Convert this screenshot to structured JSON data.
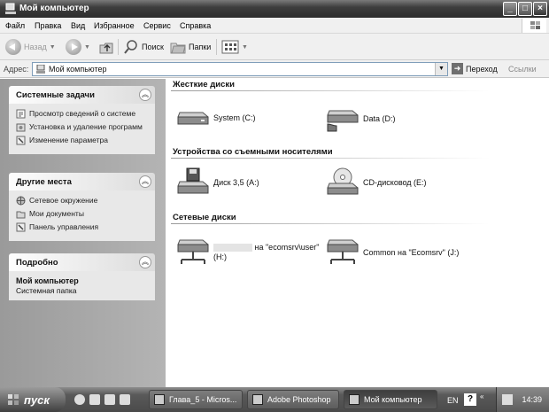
{
  "window": {
    "title": "Мой компьютер"
  },
  "menu": [
    "Файл",
    "Правка",
    "Вид",
    "Избранное",
    "Сервис",
    "Справка"
  ],
  "toolbar": {
    "back": "Назад",
    "search": "Поиск",
    "folders": "Папки"
  },
  "address": {
    "label": "Адрес:",
    "value": "Мой компьютер",
    "go": "Переход",
    "links": "Ссылки"
  },
  "sidebar": {
    "system_tasks": {
      "title": "Системные задачи",
      "items": [
        "Просмотр сведений о системе",
        "Установка и удаление программ",
        "Изменение параметра"
      ]
    },
    "other_places": {
      "title": "Другие места",
      "items": [
        "Сетевое окружение",
        "Мои документы",
        "Панель управления"
      ]
    },
    "details": {
      "title": "Подробно",
      "name": "Мой компьютер",
      "type": "Системная папка"
    }
  },
  "groups": {
    "hard_disks": {
      "title": "Жесткие диски",
      "drives": [
        {
          "label": "System (C:)",
          "icon": "hard-disk-icon"
        },
        {
          "label": "Data (D:)",
          "icon": "hard-disk-icon"
        }
      ]
    },
    "removable": {
      "title": "Устройства со съемными носителями",
      "drives": [
        {
          "label": "Диск 3,5 (A:)",
          "icon": "floppy-drive-icon"
        },
        {
          "label": "CD-дисковод (E:)",
          "icon": "cd-drive-icon"
        }
      ]
    },
    "network": {
      "title": "Сетевые диски",
      "drives": [
        {
          "label_line1": "на \"ecomsrv\\user\"",
          "label_line2": "(H:)",
          "icon": "network-drive-icon"
        },
        {
          "label": "Common на \"Ecomsrv\" (J:)",
          "icon": "network-drive-icon"
        }
      ]
    }
  },
  "taskbar": {
    "start": "пуск",
    "tasks": [
      "Глава_5 - Micros...",
      "Adobe Photoshop",
      "Мой компьютер"
    ],
    "lang": "EN",
    "clock": "14:39"
  }
}
